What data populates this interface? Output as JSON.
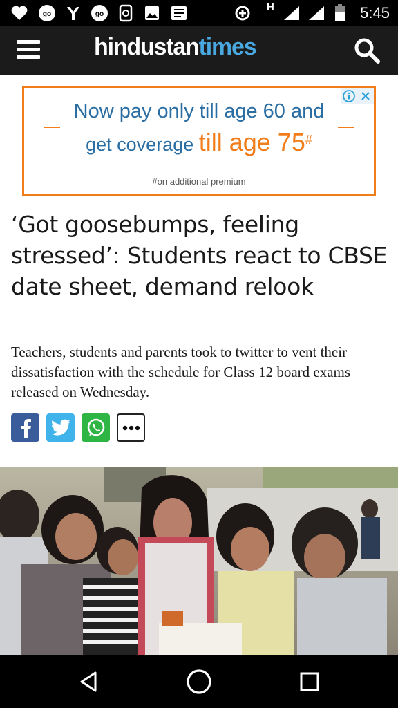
{
  "status_bar": {
    "time": "5:45",
    "network_label": "H",
    "icons": [
      "heart-icon",
      "go-icon",
      "yahoo-y-icon",
      "go-icon",
      "phone-app-icon",
      "image-icon",
      "news-icon",
      "data-saver-icon",
      "signal-icon",
      "signal-icon",
      "battery-icon"
    ]
  },
  "header": {
    "logo_part1": "hindustan",
    "logo_part2": "times",
    "logo_color_primary": "#ffffff",
    "logo_color_accent": "#4aa8e0"
  },
  "ad": {
    "line1": "Now pay only till age 60 and",
    "line2_prefix": "get coverage ",
    "line2_highlight": "till age 75",
    "line2_sup": "#",
    "note": "#on additional premium",
    "accent_color": "#f07d1a",
    "text_color": "#2a6ea3"
  },
  "article": {
    "headline": "‘Got goosebumps, feeling stressed’: Students react to CBSE date sheet, demand relook",
    "summary": "Teachers, students and parents took to twitter to vent their dissatisfaction with the schedule for Class 12 board exams released on Wednesday."
  },
  "share": {
    "buttons": [
      "facebook-icon",
      "twitter-icon",
      "whatsapp-icon",
      "more-icon"
    ],
    "colors": {
      "facebook": "#3b5c9a",
      "twitter": "#3fb3ea",
      "whatsapp": "#2fb543"
    }
  }
}
